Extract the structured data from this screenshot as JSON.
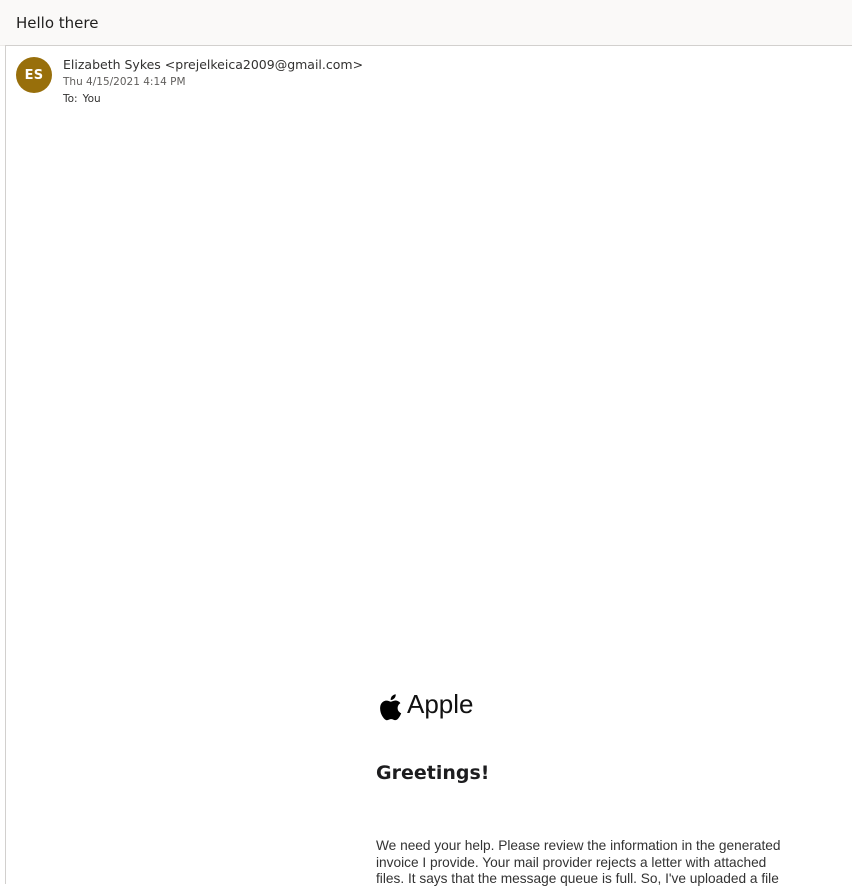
{
  "message": {
    "subject": "Hello there",
    "avatar_initials": "ES",
    "avatar_color": "#986f0b",
    "sender": "Elizabeth Sykes <prejelkeica2009@gmail.com>",
    "date": "Thu 4/15/2021 4:14 PM",
    "to_label": "To:",
    "to_value": "You"
  },
  "email_body": {
    "brand_icon": "apple-logo-icon",
    "brand_name": "Apple",
    "greeting": "Greetings!",
    "paragraph": "We need your help. Please review the information in the generated invoice I provide. Your mail provider rejects a letter with attached files. It says that the message queue is full. So, I've uploaded a file"
  }
}
